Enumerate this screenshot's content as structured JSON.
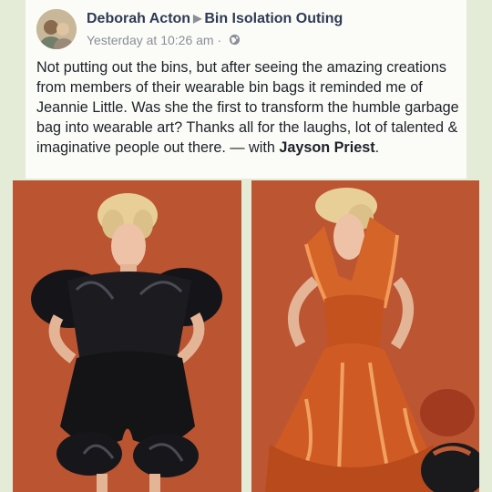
{
  "post": {
    "author": "Deborah Acton",
    "group": "Bin Isolation Outing",
    "time": "Yesterday at 10:26 am",
    "separator": "·",
    "text": "Not putting out the bins, but after seeing the amazing creations from members of their wearable bin bags it reminded me of Jeannie Little. Was she the first to transform the humble garbage bag into wearable art? Thanks all for the laughs, lot of talented & imaginative people out there. — with ",
    "tagged": "Jayson Priest",
    "end": "."
  },
  "icons": {
    "header_separator": "triangle-right-icon",
    "audience": "globe-icon"
  },
  "colors": {
    "background": "#e4ecd8",
    "card": "#fbfcf7",
    "author": "#2f3a55",
    "meta": "#8a8f98",
    "photo_background": "#c05a35",
    "dress_black": "#141417",
    "dress_orange": "#cf5a24"
  },
  "photos": [
    {
      "subject": "woman in black garbage bag outfit"
    },
    {
      "subject": "woman in orange garbage bag dress"
    }
  ]
}
